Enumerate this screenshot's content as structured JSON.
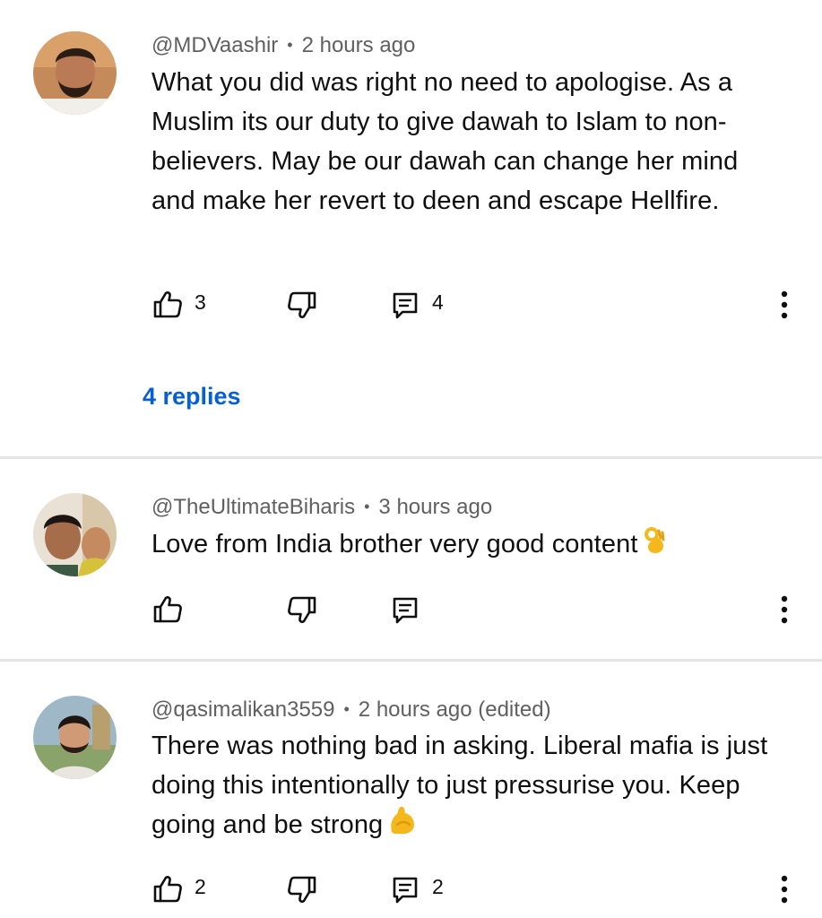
{
  "comments": [
    {
      "author": "@MDVaashir",
      "time": "2 hours ago",
      "text": "What you did was right no need to apologise. As a Muslim its our duty to give dawah to Islam to non-believers. May be our dawah can change her mind and make her revert to deen and escape Hellfire.",
      "likes": "3",
      "replies_count": "4",
      "replies_link": "4 replies"
    },
    {
      "author": "@TheUltimateBiharis",
      "time": "3 hours ago",
      "text": "Love from India brother very good content",
      "emoji": "ok-hand-emoji",
      "likes": "",
      "replies_count": ""
    },
    {
      "author": "@qasimalikan3559",
      "time": "2 hours ago (edited)",
      "text": "There was nothing bad in asking. Liberal mafia is just doing this intentionally to just pressurise you. Keep going and be strong",
      "emoji": "flexed-biceps-emoji",
      "likes": "2",
      "replies_count": "2"
    }
  ],
  "meta_separator": "•",
  "icons": [
    "thumbs-up-icon",
    "thumbs-down-icon",
    "reply-icon",
    "more-vert-icon"
  ],
  "colors": {
    "link": "#065fd4",
    "meta": "#606060",
    "divider": "#e5e5e5"
  }
}
